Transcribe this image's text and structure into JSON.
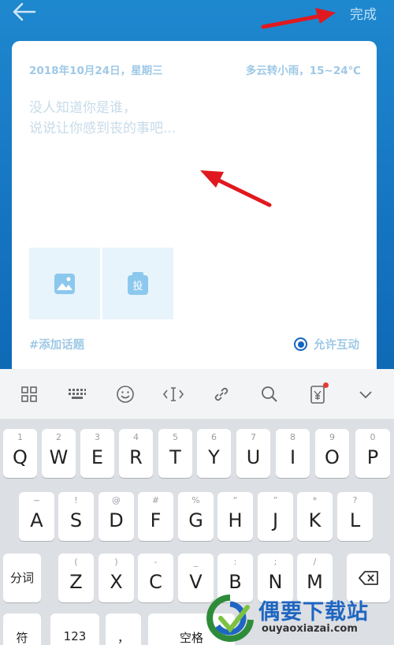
{
  "header": {
    "back_icon": "back-arrow-icon",
    "done_label": "完成"
  },
  "card": {
    "date": "2018年10月24日，星期三",
    "weather": "多云转小雨，15~24℃",
    "placeholder_line1": "没人知道你是谁，",
    "placeholder_line2": "说说让你感到丧的事吧...",
    "tiles": [
      {
        "icon": "image-icon"
      },
      {
        "icon": "vote-icon",
        "label": "投"
      }
    ],
    "topic_label": "#添加话题",
    "interact_label": "允许互动"
  },
  "keyboard_toolbar": {
    "icons": [
      "grid-icon",
      "keyboard-icon",
      "emoji-icon",
      "cursor-icon",
      "link-icon",
      "search-icon",
      "clipboard-icon",
      "chevron-down-icon"
    ]
  },
  "keyboard": {
    "row1": [
      {
        "sub": "1",
        "main": "Q"
      },
      {
        "sub": "2",
        "main": "W"
      },
      {
        "sub": "3",
        "main": "E"
      },
      {
        "sub": "4",
        "main": "R"
      },
      {
        "sub": "5",
        "main": "T"
      },
      {
        "sub": "6",
        "main": "Y"
      },
      {
        "sub": "7",
        "main": "U"
      },
      {
        "sub": "8",
        "main": "I"
      },
      {
        "sub": "9",
        "main": "O"
      },
      {
        "sub": "0",
        "main": "P"
      }
    ],
    "row2": [
      {
        "sub": "~",
        "main": "A"
      },
      {
        "sub": "!",
        "main": "S"
      },
      {
        "sub": "@",
        "main": "D"
      },
      {
        "sub": "#",
        "main": "F"
      },
      {
        "sub": "%",
        "main": "G"
      },
      {
        "sub": "“",
        "main": "H"
      },
      {
        "sub": "”",
        "main": "J"
      },
      {
        "sub": "*",
        "main": "K"
      },
      {
        "sub": "?",
        "main": "L"
      }
    ],
    "row3_left": "分词",
    "row3": [
      {
        "sub": "(",
        "main": "Z"
      },
      {
        "sub": ")",
        "main": "X"
      },
      {
        "sub": "-",
        "main": "C"
      },
      {
        "sub": "_",
        "main": "V"
      },
      {
        "sub": ":",
        "main": "B"
      },
      {
        "sub": ";",
        "main": "N"
      },
      {
        "sub": "/",
        "main": "M"
      }
    ],
    "row4": {
      "symbol_label": "符",
      "num_label": "123",
      "comma_label": "，",
      "space_label": "空格"
    }
  },
  "watermark": {
    "title": "偶要下载站",
    "sub": "ouyaoxiazai.com"
  },
  "colors": {
    "header_blue": "#1574c0",
    "accent": "#1565c0",
    "arrow_red": "#e0191f"
  }
}
